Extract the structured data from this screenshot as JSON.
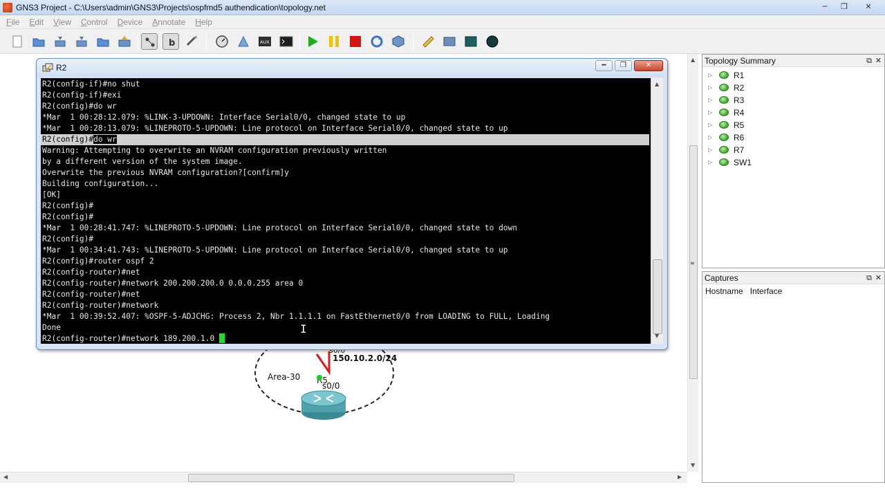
{
  "window": {
    "title": "GNS3 Project - C:\\Users\\admin\\GNS3\\Projects\\ospfmd5 authendication\\topology.net",
    "buttons": [
      "─",
      "❐",
      "✕"
    ]
  },
  "menu": {
    "items": [
      {
        "first": "F",
        "rest": "ile"
      },
      {
        "first": "E",
        "rest": "dit"
      },
      {
        "first": "V",
        "rest": "iew"
      },
      {
        "first": "C",
        "rest": "ontrol"
      },
      {
        "first": "D",
        "rest": "evice"
      },
      {
        "first": "A",
        "rest": "nnotate"
      },
      {
        "first": "H",
        "rest": "elp"
      }
    ]
  },
  "colors": {
    "start": "#1fae1f",
    "suspend": "#f2c200",
    "stop": "#d41414",
    "cursor": "#22dd22"
  },
  "topology_summary": {
    "title": "Topology Summary",
    "devices": [
      "R1",
      "R2",
      "R3",
      "R4",
      "R5",
      "R6",
      "R7",
      "SW1"
    ]
  },
  "captures": {
    "title": "Captures",
    "columns": [
      "Hostname",
      "Interface"
    ]
  },
  "canvas": {
    "area_label": "Area-30",
    "link_label": "150.10.2.0/24",
    "iface_top": "s0/0",
    "iface_bottom": "s0/0",
    "router_label": "R5"
  },
  "console": {
    "title": "R2",
    "lines": [
      "R2(config-if)#no shut",
      "R2(config-if)#exi",
      "R2(config)#do wr",
      "*Mar  1 00:28:12.079: %LINK-3-UPDOWN: Interface Serial0/0, changed state to up",
      "*Mar  1 00:28:13.079: %LINEPROTO-5-UPDOWN: Line protocol on Interface Serial0/0, changed state to up",
      "R2(config)#",
      "Warning: Attempting to overwrite an NVRAM configuration previously written",
      "by a different version of the system image.",
      "Overwrite the previous NVRAM configuration?[confirm]y",
      "Building configuration...",
      "[OK]",
      "R2(config)#",
      "R2(config)#",
      "*Mar  1 00:28:41.747: %LINEPROTO-5-UPDOWN: Line protocol on Interface Serial0/0, changed state to down",
      "R2(config)#",
      "*Mar  1 00:34:41.743: %LINEPROTO-5-UPDOWN: Line protocol on Interface Serial0/0, changed state to up",
      "R2(config)#router ospf 2",
      "R2(config-router)#net",
      "R2(config-router)#network 200.200.200.0 0.0.0.255 area 0",
      "R2(config-router)#net",
      "R2(config-router)#network",
      "*Mar  1 00:39:52.407: %OSPF-5-ADJCHG: Process 2, Nbr 1.1.1.1 on FastEthernet0/0 from LOADING to FULL, Loading",
      "Done",
      "R2(config-router)#network 189.200.1.0 "
    ],
    "highlight_selected": "do wr"
  }
}
